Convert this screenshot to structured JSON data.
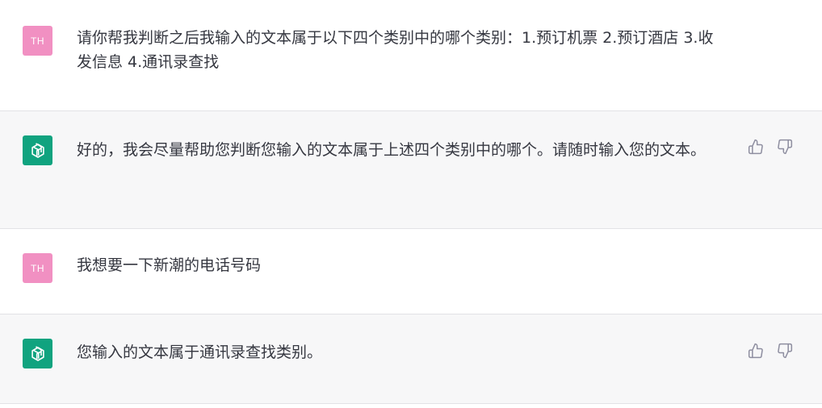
{
  "messages": [
    {
      "role": "user",
      "avatar_initials": "TH",
      "text": "请你帮我判断之后我输入的文本属于以下四个类别中的哪个类别：1.预订机票 2.预订酒店 3.收发信息 4.通讯录查找"
    },
    {
      "role": "assistant",
      "text": "好的，我会尽量帮助您判断您输入的文本属于上述四个类别中的哪个。请随时输入您的文本。"
    },
    {
      "role": "user",
      "avatar_initials": "TH",
      "text": "我想要一下新潮的电话号码"
    },
    {
      "role": "assistant",
      "text": "您输入的文本属于通讯录查找类别。"
    }
  ],
  "icons": {
    "assistant_avatar": "openai-logo-icon",
    "like": "thumbs-up-icon",
    "dislike": "thumbs-down-icon"
  },
  "colors": {
    "user_avatar_bg": "#f190c2",
    "assistant_avatar_bg": "#10a37f",
    "assistant_row_bg": "#f7f7f8",
    "text": "#353740",
    "icon": "#8e8ea0"
  }
}
